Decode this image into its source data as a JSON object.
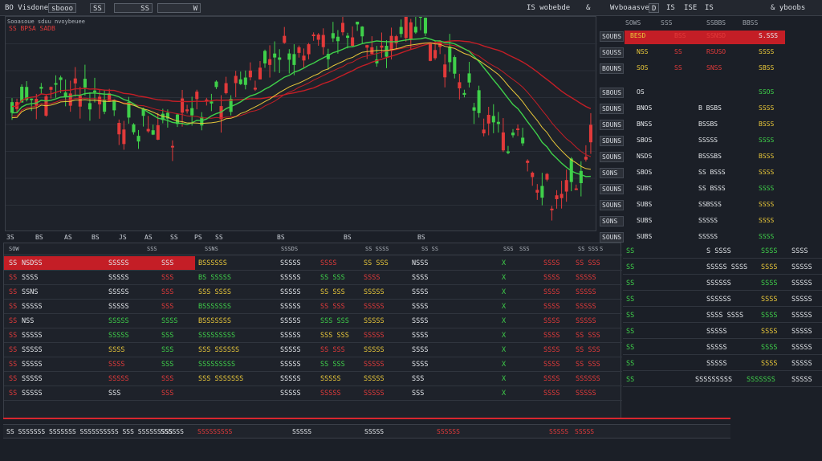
{
  "topbar": {
    "left": [
      "BO Visdones",
      "sbooo",
      "SS",
      "SS",
      "W"
    ],
    "right": [
      "IS wobebde",
      "&",
      "Wvboaasve",
      "D",
      "IS",
      "ISE",
      "IS",
      "& yboobs"
    ]
  },
  "chart": {
    "title": "Sooasoue sduu nvoybeuee",
    "subtitle": "SS BPSA  SADB",
    "x_ticks": [
      "3S",
      "BS",
      "AS",
      "BS",
      "JS",
      "AS",
      "SS",
      "PS",
      "SS",
      "BS",
      "BS",
      "BS"
    ],
    "colors": {
      "up": "#3fd04a",
      "down": "#e23a3a",
      "ma1": "#3fd04a",
      "ma2": "#c41e26",
      "ma3": "#e8c73a"
    }
  },
  "side": {
    "header": [
      "SOWS",
      "SSS",
      "SSBBS",
      "BBSS"
    ],
    "rows": [
      {
        "a": "SOUBS",
        "b": "BESD",
        "c": "BSS",
        "d": "SSNSD",
        "e": "S.SSS",
        "hl": true
      },
      {
        "a": "SOUSS",
        "b": "NSS",
        "c": "SS",
        "d": "RSUSO",
        "e": "SSSS"
      },
      {
        "a": "BOUNS",
        "b": "SOS",
        "c": "SS",
        "d": "SNSS",
        "e": "SBSS"
      },
      {
        "a": "SBOUS",
        "b": "OS",
        "c": "",
        "d": "",
        "e": "SSOS"
      },
      {
        "a": "SDUNS",
        "b": "BNOS",
        "c": "",
        "d": "B BSBS",
        "e": "SSSS"
      },
      {
        "a": "SDUNS",
        "b": "BNSS",
        "c": "",
        "d": "BSSBS",
        "e": "BSSS"
      },
      {
        "a": "SDUNS",
        "b": "SBOS",
        "c": "",
        "d": "SSSSS",
        "e": "SSSS"
      },
      {
        "a": "SOUNS",
        "b": "NSDS",
        "c": "",
        "d": "BSSSBS",
        "e": "BSSS"
      },
      {
        "a": "SONS",
        "b": "SBOS",
        "c": "",
        "d": "SS BSSS",
        "e": "SSSS"
      },
      {
        "a": "SOUNS",
        "b": "SUBS",
        "c": "",
        "d": "SS BSSS",
        "e": "SSSS"
      },
      {
        "a": "SOUNS",
        "b": "SUBS",
        "c": "",
        "d": "SSBSSS",
        "e": "SSSS"
      },
      {
        "a": "SONS",
        "b": "SUBS",
        "c": "",
        "d": "SSSSS",
        "e": "SSSS"
      },
      {
        "a": "SOUNS",
        "b": "SUBS",
        "c": "",
        "d": "SSSSS",
        "e": "SSSS"
      }
    ]
  },
  "table": {
    "headers": [
      "SOW",
      "SSS",
      "SSNS",
      "SSSDS",
      "SS SSSS",
      "SS SS",
      "SSS",
      "SSS",
      "SS SSS",
      "S"
    ],
    "rows": [
      {
        "n": "SS",
        "s": "NSDSS",
        "p": "SSSSS",
        "c": "SSS",
        "d": "BSSSSSS",
        "v": "SSSSS",
        "v2": "SSSS",
        "v3": "SS SSS",
        "x": "NSSS",
        "k": "X",
        "q": "SSSS",
        "z": "SS SSS",
        "pc": "r",
        "cc": "r",
        "hl": true
      },
      {
        "n": "SS",
        "s": "SSSS",
        "p": "SSSSS",
        "c": "SSS",
        "d": "BS SSSSS",
        "v": "SSSSS",
        "v2": "SS SSS",
        "v3": "SSSS",
        "x": "SSSS",
        "k": "X",
        "q": "SSSS",
        "z": "SSSSS",
        "pc": "w",
        "cc": "r"
      },
      {
        "n": "SS",
        "s": "SSNS",
        "p": "SSSSS",
        "c": "SSS",
        "d": "SSS SSSS",
        "v": "SSSSS",
        "v2": "SS SSS",
        "v3": "SSSSS",
        "x": "SSSS",
        "k": "X",
        "q": "SSSS",
        "z": "SSSSS",
        "pc": "w",
        "cc": "r"
      },
      {
        "n": "SS",
        "s": "SSSSS",
        "p": "SSSSS",
        "c": "SSS",
        "d": "BSSSSSSS",
        "v": "SSSSS",
        "v2": "SS SSS",
        "v3": "SSSSS",
        "x": "SSSS",
        "k": "X",
        "q": "SSSS",
        "z": "SSSSS",
        "pc": "w",
        "cc": "r"
      },
      {
        "n": "SS",
        "s": "NSS",
        "p": "SSSSS",
        "c": "SSSS",
        "d": "BSSSSSSS",
        "v": "SSSSS",
        "v2": "SSS SSS",
        "v3": "SSSSS",
        "x": "SSSS",
        "k": "X",
        "q": "SSSS",
        "z": "SSSSS",
        "pc": "g",
        "cc": "g"
      },
      {
        "n": "SS",
        "s": "SSSSS",
        "p": "SSSSS",
        "c": "SSS",
        "d": "SSSSSSSSS",
        "v": "SSSSS",
        "v2": "SSS SSS",
        "v3": "SSSSS",
        "x": "SSSS",
        "k": "X",
        "q": "SSSS",
        "z": "SS SSS",
        "pc": "g",
        "cc": "g"
      },
      {
        "n": "SS",
        "s": "SSSSS",
        "p": "SSSS",
        "c": "SSS",
        "d": "SSS SSSSSS",
        "v": "SSSSS",
        "v2": "SS SSS",
        "v3": "SSSSS",
        "x": "SSSS",
        "k": "X",
        "q": "SSSS",
        "z": "SS SSS",
        "pc": "y",
        "cc": "g"
      },
      {
        "n": "SS",
        "s": "SSSSS",
        "p": "SSSS",
        "c": "SSS",
        "d": "SSSSSSSSS",
        "v": "SSSSS",
        "v2": "SS SSS",
        "v3": "SSSSS",
        "x": "SSSS",
        "k": "X",
        "q": "SSSS",
        "z": "SS SSS",
        "pc": "r",
        "cc": "g"
      },
      {
        "n": "SS",
        "s": "SSSSS",
        "p": "SSSSS",
        "c": "SSS",
        "d": "SSS SSSSSSS",
        "v": "SSSSS",
        "v2": "SSSSS",
        "v3": "SSSSS",
        "x": "SSS",
        "k": "X",
        "q": "SSSS",
        "z": "SSSSSS",
        "pc": "r",
        "cc": "r"
      },
      {
        "n": "SS",
        "s": "SSSSS",
        "p": "SSS",
        "c": "SSS",
        "d": "",
        "v": "SSSSS",
        "v2": "SSSSS",
        "v3": "SSSSS",
        "x": "SSS",
        "k": "X",
        "q": "SSSS",
        "z": "SSSSS",
        "pc": "w",
        "cc": "r"
      }
    ]
  },
  "right_table": {
    "rows": [
      {
        "a": "SS",
        "b": "S SSSS",
        "c": "SSSS",
        "d": "SSSS"
      },
      {
        "a": "SS",
        "b": "SSSSS SSSS",
        "c": "SSSS",
        "d": "SSSSS"
      },
      {
        "a": "SS",
        "b": "SSSSSS",
        "c": "SSSS",
        "d": "SSSSS"
      },
      {
        "a": "SS",
        "b": "SSSSSS",
        "c": "SSSS",
        "d": "SSSSS"
      },
      {
        "a": "SS",
        "b": "SSSS SSSS",
        "c": "SSSS",
        "d": "SSSSS"
      },
      {
        "a": "SS",
        "b": "SSSSS",
        "c": "SSSS",
        "d": "SSSSS"
      },
      {
        "a": "SS",
        "b": "SSSSS",
        "c": "SSSS",
        "d": "SSSSS"
      },
      {
        "a": "SS",
        "b": "SSSSS",
        "c": "SSSS",
        "d": "SSSSS"
      },
      {
        "a": "SS",
        "b": "SSSSSSSSS",
        "c": "SSSSSSS",
        "d": "SSSSS"
      }
    ]
  },
  "bottom": {
    "items": [
      "SS SSSSSSS SSSSSSS SSSSSSSSSS SSS SSSSSSSSS",
      "SSSSSS",
      "SSSSSSSSS",
      "SSSSS",
      "SSSSS",
      "SSSSSS",
      "SSSSS",
      "SSSSS"
    ]
  }
}
